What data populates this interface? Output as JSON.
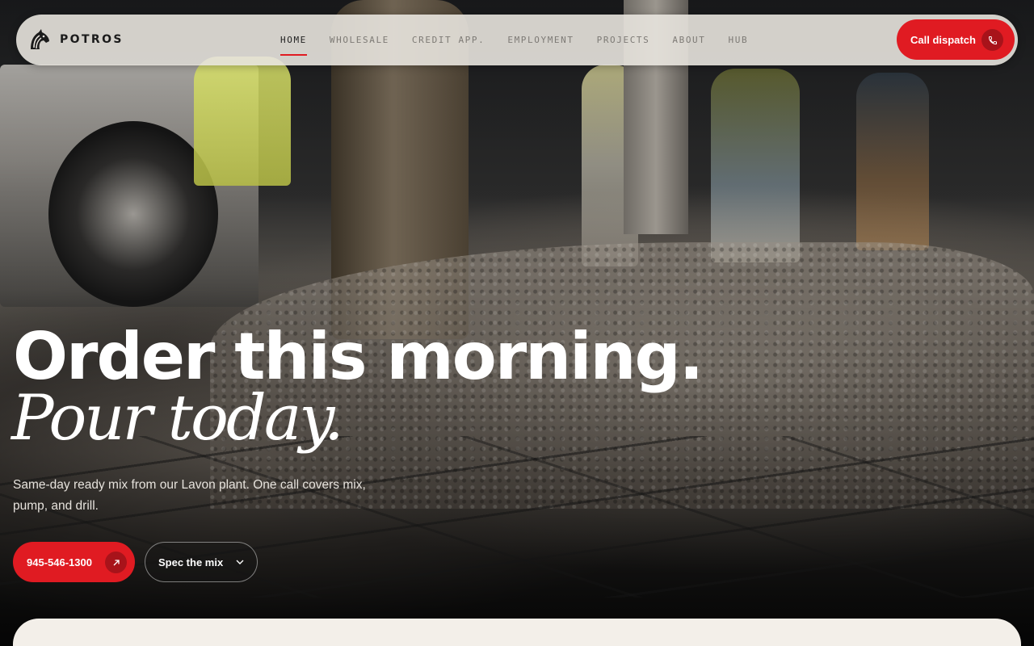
{
  "brand": {
    "name": "POTROS",
    "logo_icon": "horse-head-icon"
  },
  "nav": {
    "items": [
      {
        "label": "HOME",
        "active": true
      },
      {
        "label": "WHOLESALE",
        "active": false
      },
      {
        "label": "CREDIT APP.",
        "active": false
      },
      {
        "label": "EMPLOYMENT",
        "active": false
      },
      {
        "label": "PROJECTS",
        "active": false
      },
      {
        "label": "ABOUT",
        "active": false
      },
      {
        "label": "HUB",
        "active": false
      }
    ],
    "cta": {
      "label": "Call dispatch",
      "icon": "phone-icon"
    }
  },
  "hero": {
    "headline": "Order this morning.",
    "headline_italic": "Pour today.",
    "subtext": "Same-day ready mix from our Lavon plant. One call covers mix, pump, and drill.",
    "primary_button": {
      "label": "945-546-1300",
      "icon": "arrow-up-right-icon"
    },
    "secondary_button": {
      "label": "Spec the mix",
      "icon": "chevron-down-icon"
    }
  },
  "colors": {
    "accent": "#e01b22",
    "accent_dark": "#a8131a",
    "nav_bg": "#e8e4de",
    "panel_bg": "#f3efe9"
  }
}
